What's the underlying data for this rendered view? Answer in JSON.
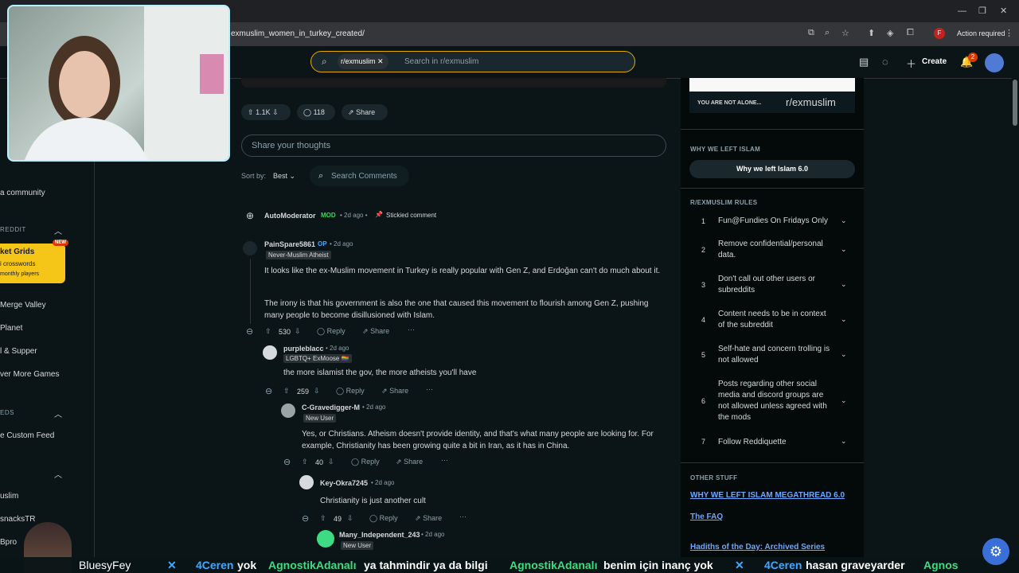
{
  "browser": {
    "url": "exmuslim_women_in_turkey_created/",
    "action_required": "Action required",
    "profile_initial": "F"
  },
  "header": {
    "search_chip": "r/exmuslim",
    "search_placeholder": "Search in r/exmuslim",
    "create_label": "Create",
    "notification_count": "2"
  },
  "left_sidebar": {
    "community_label": "a community",
    "section_reddit": "REDDIT",
    "promo_title": "ket Grids",
    "promo_sub": "i crosswords",
    "promo_players": "monthly players",
    "promo_badge": "NEW",
    "games": [
      "Merge Valley",
      "Planet",
      "l & Supper",
      "ver More Games"
    ],
    "section_feeds": "EDS",
    "custom_feed": "e Custom Feed",
    "communities": [
      "uslim",
      "snacksTR",
      "Bpro"
    ]
  },
  "post_actions": {
    "votes": "1.1K",
    "comments": "118",
    "share": "Share"
  },
  "share_thoughts_placeholder": "Share your thoughts",
  "sort": {
    "label": "Sort by:",
    "value": "Best",
    "search_comments": "Search Comments"
  },
  "automod": {
    "user": "AutoModerator",
    "badge": "MOD",
    "time": "• 2d ago •",
    "stickied": "Stickied comment"
  },
  "comments": [
    {
      "user": "PainSpare5861",
      "op": "OP",
      "time": "• 2d ago",
      "flair": "Never-Muslim Atheist",
      "p1": "It looks like the ex-Muslim movement in Turkey is really popular with Gen Z, and Erdoğan can't do much about it.",
      "p2": "The irony is that his government is also the one that caused this movement to flourish among Gen Z, pushing many people to become disillusioned with Islam.",
      "votes": "530",
      "reply": "Reply",
      "share": "Share"
    },
    {
      "user": "purpleblacc",
      "time": "• 2d ago",
      "flair": "LGBTQ+ ExMoose 🏳️‍🌈",
      "p1": "the more islamist the gov, the more atheists you'll have",
      "votes": "259",
      "reply": "Reply",
      "share": "Share"
    },
    {
      "user": "C-Gravedigger-M",
      "time": "• 2d ago",
      "flair": "New User",
      "p1": "Yes, or Christians. Atheism doesn't provide identity, and that's what many people are looking for. For example, Christianity has been growing quite a bit in Iran, as it has in China.",
      "votes": "40",
      "reply": "Reply",
      "share": "Share"
    },
    {
      "user": "Key-Okra7245",
      "time": "• 2d ago",
      "p1": "Christianity is just another cult",
      "votes": "49",
      "reply": "Reply",
      "share": "Share"
    },
    {
      "user": "Many_Independent_243",
      "time": "• 2d ago",
      "flair": "New User"
    }
  ],
  "right_sidebar": {
    "banner_text_left": "YOU ARE NOT ALONE...",
    "banner_text_right": "r/exmuslim",
    "why_heading": "WHY WE LEFT ISLAM",
    "why_button": "Why we left Islam 6.0",
    "rules_heading": "R/EXMUSLIM RULES",
    "rules": [
      {
        "n": "1",
        "t": "Fun@Fundies On Fridays Only"
      },
      {
        "n": "2",
        "t": "Remove confidential/personal data."
      },
      {
        "n": "3",
        "t": "Don't call out other users or subreddits"
      },
      {
        "n": "4",
        "t": "Content needs to be in context of the subreddit"
      },
      {
        "n": "5",
        "t": "Self-hate and concern trolling is not allowed"
      },
      {
        "n": "6",
        "t": "Posts regarding other social media and discord groups are not allowed unless agreed with the mods"
      },
      {
        "n": "7",
        "t": "Follow Reddiquette"
      }
    ],
    "other_heading": "OTHER STUFF",
    "links": [
      "WHY WE LEFT ISLAM MEGATHREAD 6.0",
      "The FAQ",
      "Hadiths of the Day: Archived Series"
    ]
  },
  "stream_overlay": {
    "ticker_name": "BluesyFey",
    "ticker": [
      {
        "user": "4Ceren",
        "msg": "yok",
        "color": "#3fa9ff"
      },
      {
        "user": "AgnostikAdanalı",
        "msg": "ya tahmindir ya da bilgi",
        "color": "#3ddc84"
      },
      {
        "user": "AgnostikAdanalı",
        "msg": "benim için inanç yok",
        "color": "#3ddc84"
      },
      {
        "user": "4Ceren",
        "msg": "hasan graveyarder",
        "color": "#3fa9ff"
      },
      {
        "user": "Agnos",
        "msg": "",
        "color": "#3ddc84"
      }
    ]
  },
  "colors": {
    "accent_orange": "#d93900",
    "mod_green": "#46d160",
    "link_blue": "#6aa8ff",
    "search_border": "#e6a800"
  }
}
